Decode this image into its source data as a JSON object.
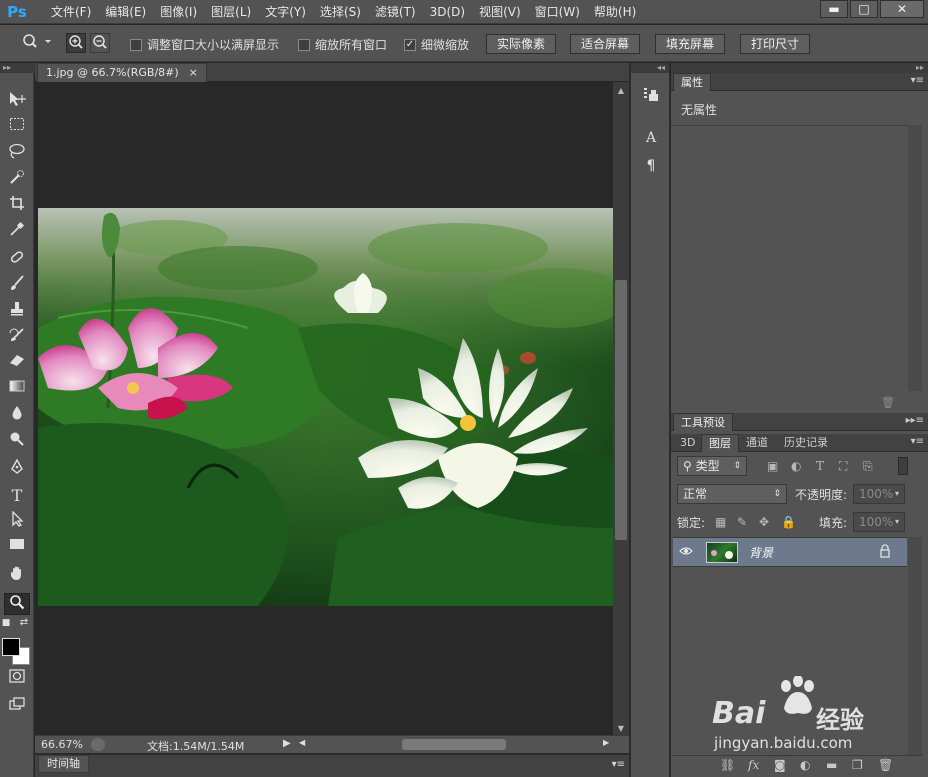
{
  "app": {
    "logo": "Ps",
    "menu": [
      "文件(F)",
      "编辑(E)",
      "图像(I)",
      "图层(L)",
      "文字(Y)",
      "选择(S)",
      "滤镜(T)",
      "3D(D)",
      "视图(V)",
      "窗口(W)",
      "帮助(H)"
    ],
    "window_controls": {
      "minimize": "▬",
      "maximize": "□",
      "close": "✕"
    }
  },
  "options": {
    "checkboxes": [
      {
        "label": "调整窗口大小以满屏显示",
        "checked": false
      },
      {
        "label": "缩放所有窗口",
        "checked": false
      },
      {
        "label": "细微缩放",
        "checked": true
      }
    ],
    "check_mark": "✓",
    "buttons": [
      "实际像素",
      "适合屏幕",
      "填充屏幕",
      "打印尺寸"
    ]
  },
  "document": {
    "tab_title": "1.jpg @ 66.7%(RGB/8#)",
    "tab_close": "×",
    "zoom": "66.67%",
    "doc_info": "文档:1.54M/1.54M"
  },
  "timeline": {
    "label": "时间轴"
  },
  "properties": {
    "tab": "属性",
    "empty_text": "无属性"
  },
  "tool_presets": {
    "tab": "工具预设"
  },
  "layers_panel": {
    "tabs": [
      "3D",
      "图层",
      "通道",
      "历史记录"
    ],
    "active_tab": "图层",
    "filter_kind": "类型",
    "blend_mode": "正常",
    "opacity_label": "不透明度:",
    "opacity_value": "100%",
    "lock_label": "锁定:",
    "fill_label": "填充:",
    "fill_value": "100%",
    "layers": [
      {
        "name": "背景",
        "visible": true,
        "locked": true
      }
    ]
  },
  "watermark": {
    "brand": "Bai",
    "brand_cn": "经验",
    "url": "jingyan.baidu.com"
  },
  "colors": {
    "ui_dark": "#535353",
    "canvas_bg": "#282828",
    "selected_layer": "#6d7a8e",
    "ps_blue": "#31a8ff"
  },
  "icons": {
    "zoom_tool": "zoom-icon",
    "zoom_in": "zoom-in-icon",
    "zoom_out": "zoom-out-icon",
    "visibility": "eye-icon",
    "lock": "lock-icon"
  }
}
